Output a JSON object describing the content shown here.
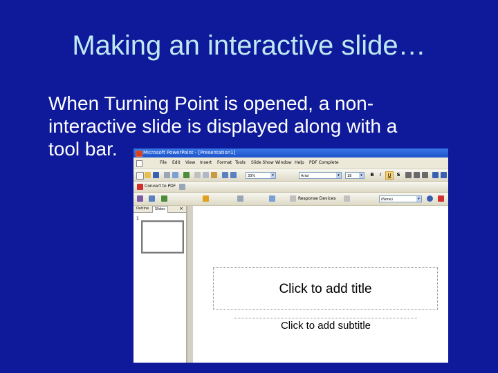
{
  "slide": {
    "title": "Making an interactive slide…",
    "body_lines": [
      "When Turning Point is opened, a non-",
      "interactive slide is displayed along with a",
      "tool bar."
    ]
  },
  "app": {
    "window_title": "Microsoft PowerPoint - [Presentation1]",
    "menu": [
      "File",
      "Edit",
      "View",
      "Insert",
      "Format",
      "Tools",
      "Slide Show",
      "Window",
      "Help",
      "PDF Complete"
    ],
    "toolbar": {
      "zoom": "33%",
      "font_name": "Arial",
      "font_size": "18"
    },
    "convert_button": "Convert to PDF",
    "turningpoint": {
      "response_devices": "Response Devices",
      "session_value": "(None)"
    },
    "pane_tabs": [
      "Outline",
      "Slides"
    ],
    "slide_number": "1",
    "placeholders": {
      "title": "Click to add title",
      "subtitle": "Click to add subtitle"
    }
  },
  "colors": {
    "background": "#0f1a9a",
    "title_text": "#bfe9f2",
    "body_text": "#ffffff",
    "titlebar": "#1c52c8"
  }
}
